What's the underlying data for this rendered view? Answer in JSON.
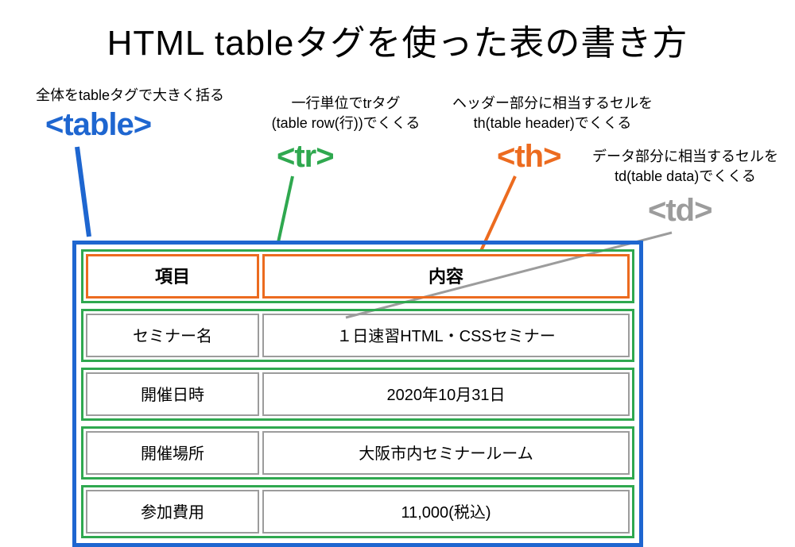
{
  "title": "HTML tableタグを使った表の書き方",
  "annotations": {
    "table": "全体をtableタグで大きく括る",
    "tr_l1": "一行単位でtrタグ",
    "tr_l2": "(table row(行))でくくる",
    "th_l1": "ヘッダー部分に相当するセルを",
    "th_l2": "th(table header)でくくる",
    "td_l1": "データ部分に相当するセルを",
    "td_l2": "td(table data)でくくる"
  },
  "tags": {
    "table": "<table>",
    "tr": "<tr>",
    "th": "<th>",
    "td": "<td>"
  },
  "colors": {
    "table": "#1e66d0",
    "tr": "#2fa84f",
    "th": "#ec6b1f",
    "td": "#9c9c9c"
  },
  "header": {
    "col1": "項目",
    "col2": "内容"
  },
  "rows": [
    {
      "col1": "セミナー名",
      "col2": "１日速習HTML・CSSセミナー"
    },
    {
      "col1": "開催日時",
      "col2": "2020年10月31日"
    },
    {
      "col1": "開催場所",
      "col2": "大阪市内セミナールーム"
    },
    {
      "col1": "参加費用",
      "col2": "11,000(税込)"
    }
  ]
}
